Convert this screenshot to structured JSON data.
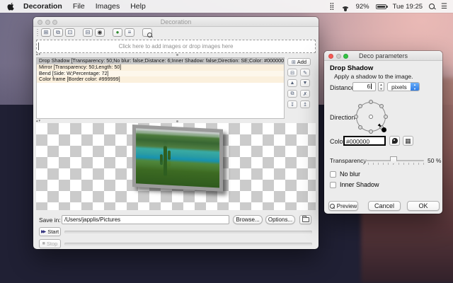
{
  "menu_bar": {
    "menus": [
      "Decoration",
      "File",
      "Images",
      "Help"
    ],
    "status": {
      "battery_percent": "92%",
      "clock": "Tue 19:25"
    }
  },
  "main_window": {
    "title": "Decoration",
    "toolbar": [
      {
        "name": "add-image",
        "glyph": "⊞"
      },
      {
        "name": "paste-image",
        "glyph": "⧉"
      },
      {
        "name": "add-folder",
        "glyph": "⊡"
      },
      {
        "name": "remove-image",
        "glyph": "⊟"
      },
      {
        "name": "rotate-image",
        "glyph": "◉"
      },
      {
        "name": "web-image",
        "glyph": "●"
      },
      {
        "name": "image-list",
        "glyph": "≡"
      }
    ],
    "drop_area_text": "Click here to add images or drop images here",
    "effects": [
      {
        "text": "Drop Shadow [Transparency: 50;No blur: false;Distance: 6;Inner Shadow: false;Direction: SE;Color: #000000]",
        "selected": true
      },
      {
        "text": "Mirror [Transparency: 50;Length: 50]",
        "selected": false
      },
      {
        "text": "Bend [Side: W;Percentage: 72]",
        "selected": false
      },
      {
        "text": "Color frame [Border color: #999999]",
        "selected": false
      }
    ],
    "effect_actions": {
      "add_glyph": "⊞",
      "add_label": "Add",
      "buttons": [
        {
          "name": "remove-effect",
          "glyph": "⊟"
        },
        {
          "name": "edit-effect",
          "glyph": "✎"
        },
        {
          "name": "move-effect-up",
          "glyph": "▲"
        },
        {
          "name": "move-effect-down",
          "glyph": "▼"
        },
        {
          "name": "copy-effect",
          "glyph": "⧉"
        },
        {
          "name": "delete-effect",
          "glyph": "✗"
        },
        {
          "name": "import-effects",
          "glyph": "↧"
        },
        {
          "name": "export-effects",
          "glyph": "↥"
        }
      ]
    },
    "save_row": {
      "label": "Save in:",
      "path": "/Users/japplis/Pictures",
      "browse_label": "Browse...",
      "options_label": "Options..."
    },
    "start_button": {
      "glyph": "▶▶",
      "label": "Start"
    },
    "stop_button": {
      "glyph": "■",
      "label": "Stop"
    }
  },
  "dialog": {
    "title": "Deco parameters",
    "heading": "Drop Shadow",
    "subtitle": "Apply a shadow to the image.",
    "distance_label": "Distance",
    "distance_value": "6",
    "unit_value": "pixels",
    "direction_label": "Direction",
    "direction_selected": "SE",
    "color_label": "Color",
    "color_value": "#000000",
    "transparency_label": "Transparency",
    "transparency_value": "50 %",
    "no_blur_label": "No blur",
    "no_blur_checked": false,
    "inner_shadow_label": "Inner Shadow",
    "inner_shadow_checked": false,
    "preview_label": "Preview",
    "cancel_label": "Cancel",
    "ok_label": "OK"
  },
  "colors": {
    "accent_blue": "#2e7de5",
    "selection_gray": "#c8c8c8",
    "row_cream": "#fbf0dd",
    "frame_gray": "#999999",
    "shadow_color": "#000000"
  }
}
